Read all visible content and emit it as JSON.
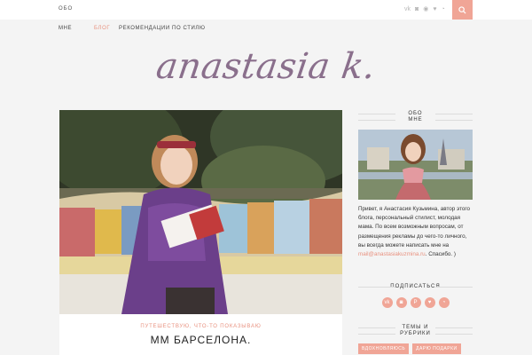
{
  "topbar": {
    "left_link": "ОБО",
    "socials": [
      {
        "icon": "vk-icon",
        "glyph": "vk"
      },
      {
        "icon": "instagram-icon",
        "glyph": "◙"
      },
      {
        "icon": "pinterest-icon",
        "glyph": "◉"
      },
      {
        "icon": "heart-icon",
        "glyph": "♥"
      },
      {
        "icon": "rss-icon",
        "glyph": "◔"
      }
    ]
  },
  "nav": {
    "items": [
      {
        "label": "МНЕ"
      },
      {
        "label": "БЛОГ"
      },
      {
        "label": "РЕКОМЕНДАЦИИ ПО СТИЛЮ"
      }
    ]
  },
  "logo": {
    "text": "anastasia k."
  },
  "post": {
    "categories": "ПУТЕШЕСТВУЮ, ЧТО-ТО ПОКАЗЫВАЮ",
    "title": "ММ БАРСЕЛОНА."
  },
  "sidebar": {
    "about_title_1": "ОБО",
    "about_title_2": "МНЕ",
    "about_text": "Привет, я Анастасия Кузьмина, автор этого блога, персональный стилист, молодая мама. По всем возможным вопросам, от размещения рекламы до чего-то личного, вы всегда можете написать мне на",
    "about_mail": "mail@anastasiakuzmina.ru",
    "about_after": ". Спасибо. )",
    "subscribe_title": "ПОДПИСАТЬСЯ",
    "socials": [
      {
        "icon": "vk-icon",
        "glyph": "vk"
      },
      {
        "icon": "instagram-icon",
        "glyph": "◙"
      },
      {
        "icon": "pinterest-icon",
        "glyph": "P"
      },
      {
        "icon": "heart-icon",
        "glyph": "♥"
      },
      {
        "icon": "rss-icon",
        "glyph": "◔"
      }
    ],
    "topics_title_1": "ТЕМЫ И",
    "topics_title_2": "РУБРИКИ",
    "tags": [
      {
        "label": "ВДОХНОВЛЯЮСЬ"
      },
      {
        "label": "ДАРЮ ПОДАРКИ"
      }
    ]
  },
  "colors": {
    "accent": "#f0a596",
    "logo": "#8a6f8c",
    "background": "#f4f4f4"
  }
}
